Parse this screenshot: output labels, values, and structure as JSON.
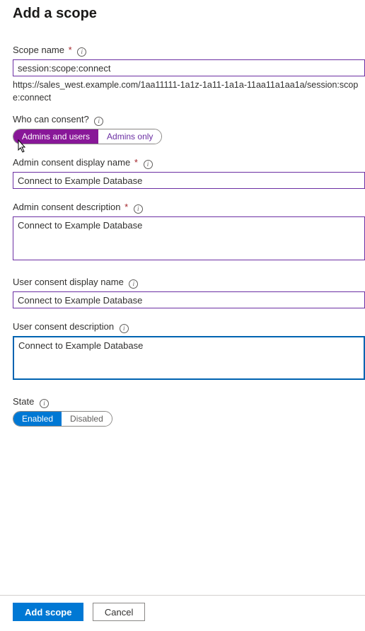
{
  "colors": {
    "accent_purple": "#881798",
    "accent_blue": "#0078d4",
    "border_purple": "#6b2fa3",
    "focus_blue": "#0063b1"
  },
  "title": "Add a scope",
  "scope_name": {
    "label": "Scope name",
    "value": "session:scope:connect",
    "helper": "https://sales_west.example.com/1aa11111-1a1z-1a11-1a1a-11aa11a1aa1a/session:scope:connect"
  },
  "consent": {
    "label": "Who can consent?",
    "options": [
      "Admins and users",
      "Admins only"
    ],
    "selected": 0
  },
  "admin_display": {
    "label": "Admin consent display name",
    "value": "Connect to Example Database"
  },
  "admin_desc": {
    "label": "Admin consent description",
    "value": "Connect to Example Database"
  },
  "user_display": {
    "label": "User consent display name",
    "value": "Connect to Example Database"
  },
  "user_desc": {
    "label": "User consent description",
    "value": "Connect to Example Database"
  },
  "state": {
    "label": "State",
    "options": [
      "Enabled",
      "Disabled"
    ],
    "selected": 0
  },
  "footer": {
    "primary": "Add scope",
    "secondary": "Cancel"
  }
}
